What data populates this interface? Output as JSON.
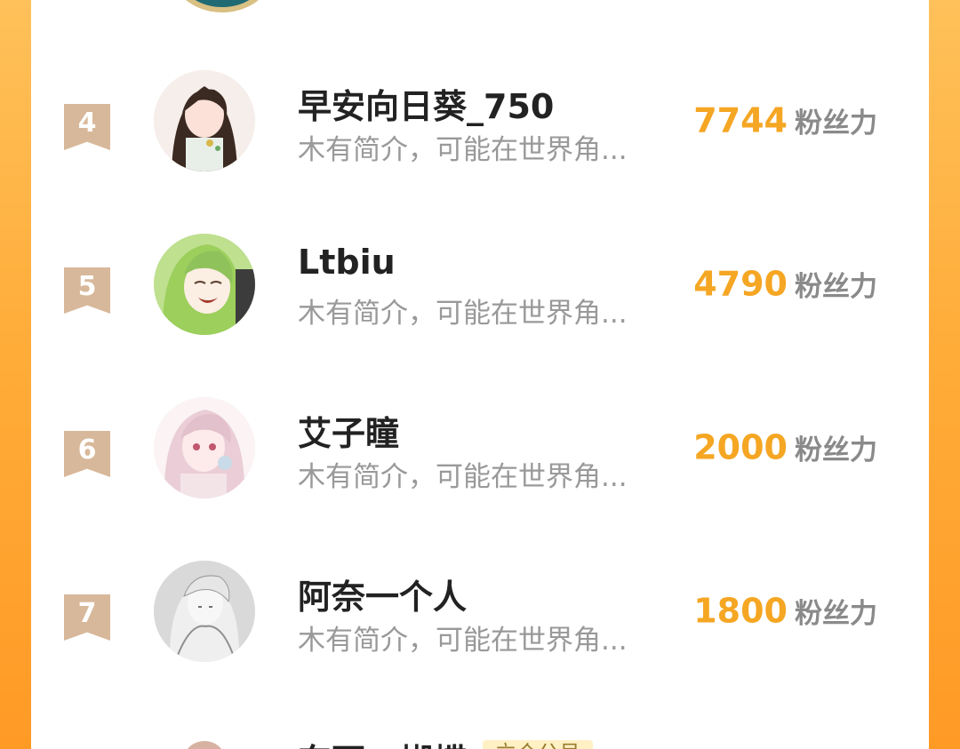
{
  "ranking": {
    "fans_label": "粉丝力",
    "rows": [
      {
        "rank": "4",
        "name": "早安向日葵_750",
        "bio": "木有简介，可能在世界角...",
        "fans": "7744"
      },
      {
        "rank": "5",
        "name": "Ltbiu",
        "bio": "木有简介，可能在世界角...",
        "fans": "4790"
      },
      {
        "rank": "6",
        "name": "艾子瞳",
        "bio": "木有简介，可能在世界角...",
        "fans": "2000"
      },
      {
        "rank": "7",
        "name": "阿奈一个人",
        "bio": "木有简介，可能在世界角...",
        "fans": "1800"
      }
    ],
    "partial_row": {
      "name": "东西一蝴蝶",
      "badge": "立个公号"
    }
  },
  "colors": {
    "background": "#ffad3a",
    "fans_count": "#f5a623",
    "rank_badge": "#d8b89a"
  }
}
